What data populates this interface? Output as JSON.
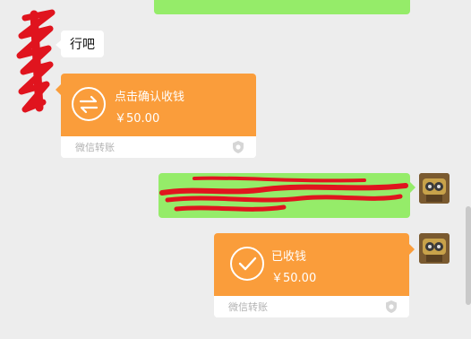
{
  "colors": {
    "background": "#ededed",
    "green_bubble": "#95ec69",
    "transfer_orange": "#fa9d3b",
    "redaction_red": "#e0141e"
  },
  "messages": {
    "incoming_text": "行吧",
    "incoming_transfer": {
      "title": "点击确认收钱",
      "amount": "￥50.00",
      "footer": "微信转账",
      "icon": "transfer-arrows-icon"
    },
    "outgoing_transfer": {
      "title": "已收钱",
      "amount": "￥50.00",
      "footer": "微信转账",
      "icon": "checkmark-icon"
    }
  },
  "avatars": {
    "left": "avatar-redacted",
    "right": "avatar-robot-cartoon"
  }
}
